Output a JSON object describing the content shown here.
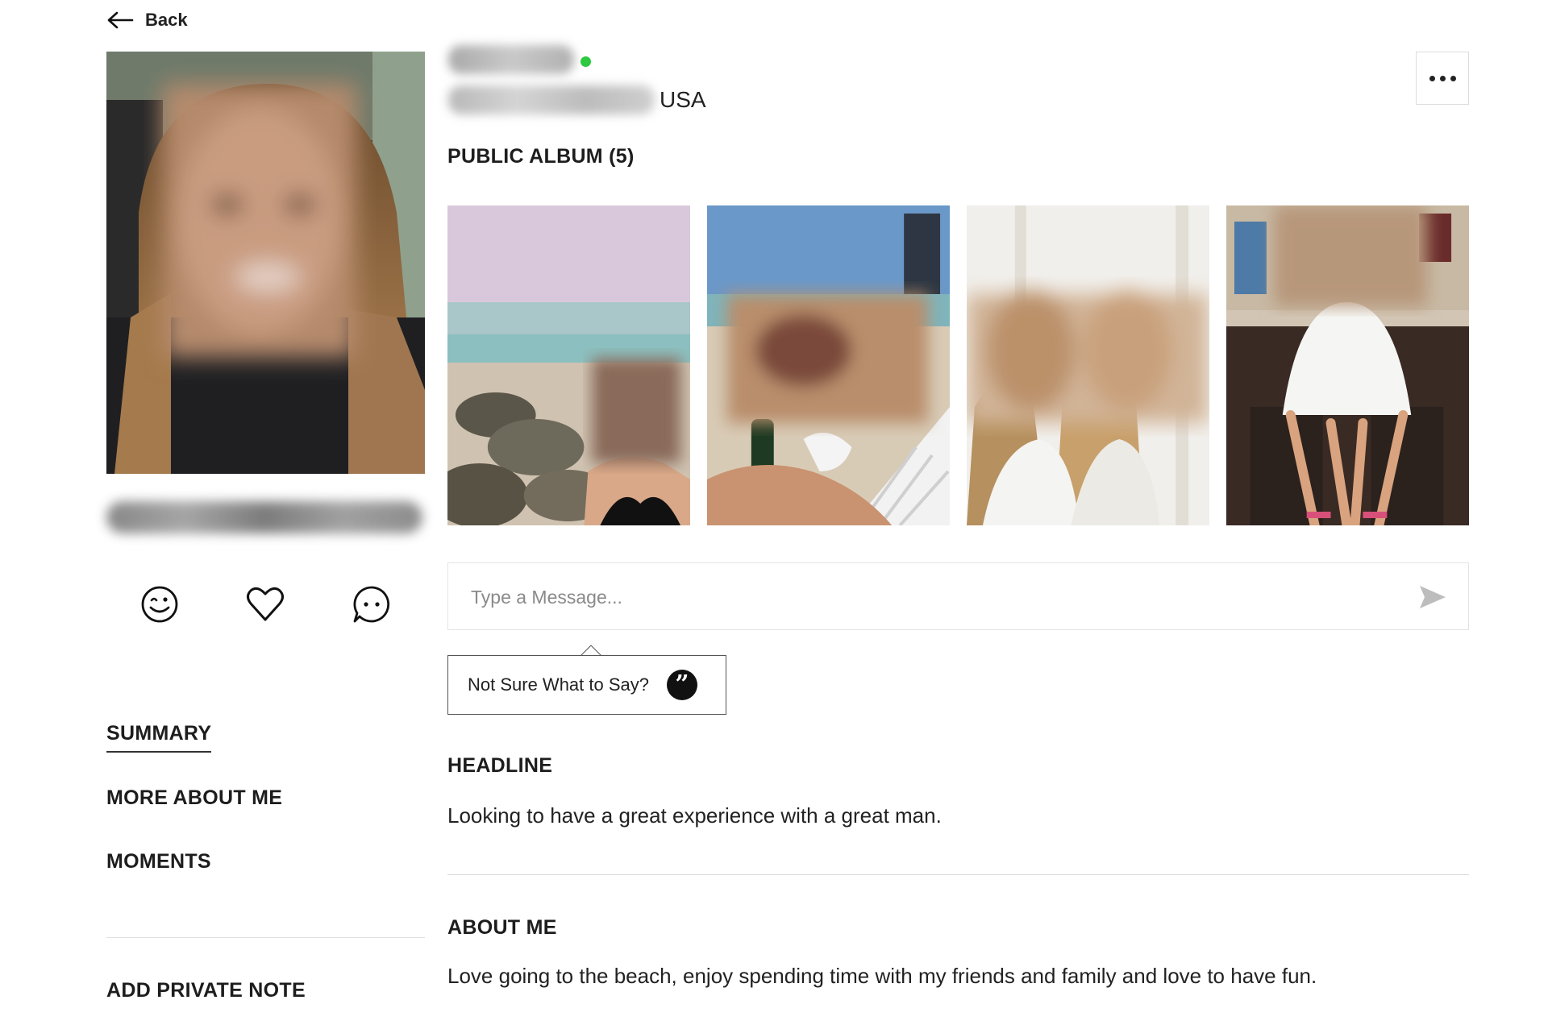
{
  "back": {
    "label": "Back"
  },
  "profile": {
    "country": "USA",
    "online": true
  },
  "album": {
    "title": "PUBLIC ALBUM (5)",
    "photos": [
      {
        "name": "beach-rocks-photo"
      },
      {
        "name": "beach-chair-photo"
      },
      {
        "name": "friends-indoor-photo"
      },
      {
        "name": "friends-seated-photo"
      }
    ]
  },
  "actions": [
    {
      "name": "wink-button",
      "icon": "wink-face-icon"
    },
    {
      "name": "favorite-button",
      "icon": "heart-icon"
    },
    {
      "name": "chat-button",
      "icon": "chat-bubble-icon"
    }
  ],
  "nav": {
    "items": [
      {
        "label": "SUMMARY",
        "active": true
      },
      {
        "label": "MORE ABOUT ME",
        "active": false
      },
      {
        "label": "MOMENTS",
        "active": false
      }
    ],
    "private_note": "ADD PRIVATE NOTE"
  },
  "message": {
    "placeholder": "Type a Message...",
    "send_icon": "send-icon"
  },
  "tooltip": {
    "label": "Not Sure What to Say?",
    "icon": "quote-icon"
  },
  "headline": {
    "title": "HEADLINE",
    "text": "Looking to have a great experience with a great man."
  },
  "about": {
    "title": "ABOUT ME",
    "text": "Love going to the beach, enjoy spending time with my friends and family and love to have fun."
  },
  "colors": {
    "online_dot": "#2ec940",
    "text": "#1d1d1d",
    "border": "#e3e3e3"
  }
}
